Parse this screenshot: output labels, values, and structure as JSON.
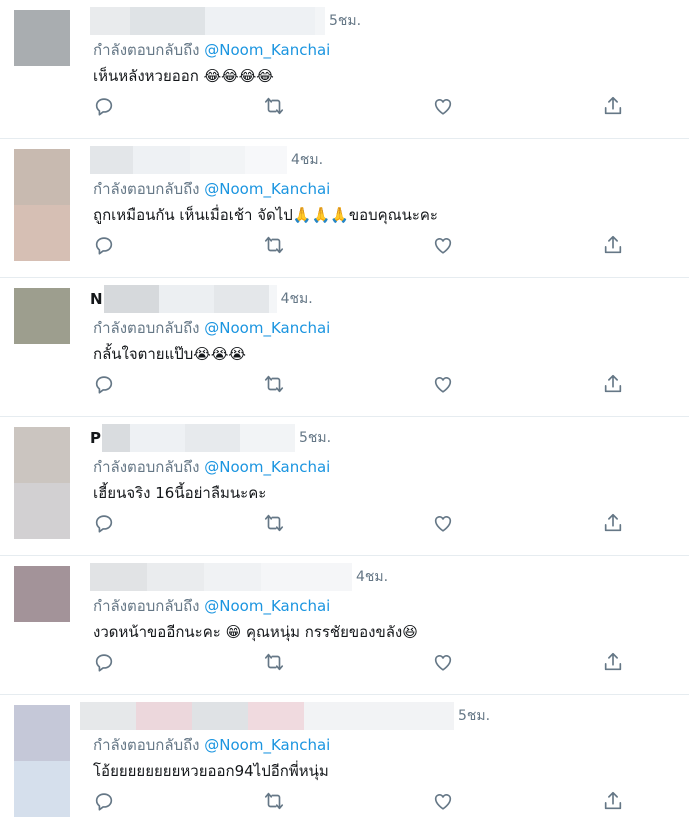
{
  "tweets": [
    {
      "time": "5ชม.",
      "reply_prefix": "กำลังตอบกลับถึง",
      "mention": "@Noom_Kanchai",
      "text": "เห็นหลังหวยออก 😂😂😂😂",
      "avatar_colors": [
        "#a9adb0",
        "#ffffff"
      ],
      "name_blur": [
        "#e9ebed",
        "#dfe3e6",
        "#eef1f4",
        "#f3f5f7"
      ]
    },
    {
      "time": "4ชม.",
      "reply_prefix": "กำลังตอบกลับถึง",
      "mention": "@Noom_Kanchai",
      "text": "ถูกเหมือนกัน เห็นเมื่อเช้า จัดไป🙏🙏🙏ขอบคุณนะคะ",
      "avatar_colors": [
        "#c8bab0",
        "#d6bfb4"
      ],
      "name_blur": [
        "#e3e6e9",
        "#eef1f4",
        "#f2f4f6",
        "#f7f8fa"
      ]
    },
    {
      "time": "4ชม.",
      "name_initial": "N",
      "reply_prefix": "กำลังตอบกลับถึง",
      "mention": "@Noom_Kanchai",
      "text": "กลั้นใจตายแป๊บ😭😭😭",
      "avatar_colors": [
        "#9d9e8e",
        "#ffffff"
      ],
      "name_blur": [
        "#d6d9dc",
        "#eceff2",
        "#e4e7ea",
        "#f4f6f8"
      ]
    },
    {
      "time": "5ชม.",
      "name_initial": "P",
      "reply_prefix": "กำลังตอบกลับถึง",
      "mention": "@Noom_Kanchai",
      "text": "เฮี้ยนจริง 16นี้อย่าลืมนะคะ",
      "avatar_colors": [
        "#cbc5c0",
        "#d2d0d2"
      ],
      "name_blur": [
        "#d9dcdf",
        "#eef1f4",
        "#e7eaed",
        "#f2f4f6"
      ]
    },
    {
      "time": "4ชม.",
      "reply_prefix": "กำลังตอบกลับถึง",
      "mention": "@Noom_Kanchai",
      "text": "งวดหน้าขออีกนะคะ 😁 คุณหนุ่ม กรรชัยของขลัง😆",
      "avatar_colors": [
        "#a39399",
        "#ffffff"
      ],
      "name_blur": [
        "#e1e3e5",
        "#eaecee",
        "#f0f2f4",
        "#f5f6f8"
      ]
    },
    {
      "time": "5ชม.",
      "reply_prefix": "กำลังตอบกลับถึง",
      "mention": "@Noom_Kanchai",
      "text": "โอ้ยยยยยยยยหวยออก94ไปอีกพี่หนุ่ม",
      "avatar_colors": [
        "#c5c8d8",
        "#d5dfec"
      ],
      "name_blur": [
        "#e6e8ea",
        "#ecd7dc",
        "#dfe2e5",
        "#f0dadf"
      ]
    }
  ],
  "actions": {
    "reply_icon": "reply-icon",
    "retweet_icon": "retweet-icon",
    "like_icon": "like-icon",
    "share_icon": "share-icon"
  },
  "colors": {
    "mention": "#1b95e0",
    "muted": "#657786",
    "divider": "#e6ecf0"
  }
}
